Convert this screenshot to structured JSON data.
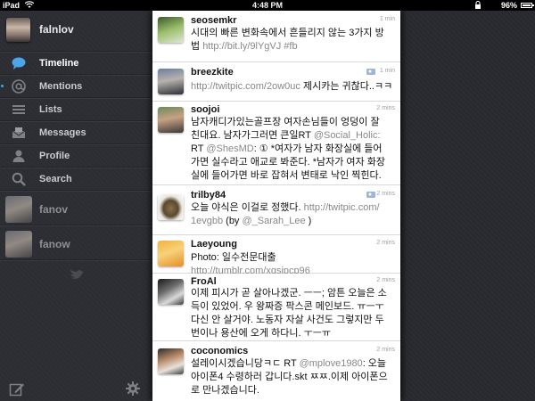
{
  "status_bar": {
    "carrier": "iPad",
    "time": "4:48 PM",
    "battery_pct": "96%",
    "battery_level": 0.96
  },
  "sidebar": {
    "account_name": "falnlov",
    "nav": [
      {
        "label": "Timeline",
        "icon": "speech-bubble-icon",
        "active": true
      },
      {
        "label": "Mentions",
        "icon": "at-sign-icon",
        "active": false,
        "unread": true
      },
      {
        "label": "Lists",
        "icon": "list-icon",
        "active": false
      },
      {
        "label": "Messages",
        "icon": "envelope-icon",
        "active": false
      },
      {
        "label": "Profile",
        "icon": "person-icon",
        "active": false
      },
      {
        "label": "Search",
        "icon": "magnifier-icon",
        "active": false
      }
    ],
    "other_accounts": [
      {
        "name": "fanov"
      },
      {
        "name": "fanow"
      }
    ],
    "compose_icon": "compose-icon",
    "settings_icon": "gear-icon"
  },
  "timeline": {
    "tweets": [
      {
        "user": "seosemkr",
        "time": "1 min",
        "line1": "시대의 빠른 변화속에서 흔들리지 않는 3가지 방",
        "line2_text": "법 ",
        "line2_link": "http://bit.ly/9lYgVJ #fb"
      },
      {
        "user": "breezkite",
        "time": "1 min",
        "link": "http://twitpic.com/2ow0uc",
        "text": " 제시카는 귀찮다..ㅋㅋ"
      },
      {
        "user": "soojoi",
        "time": "2 mins",
        "l1": "남자캐디가있는골프장 여자손님들이 엉덩이 잘",
        "l2_text": "친대요. 남자가그러면 큰일RT ",
        "l2_link": "@Social_Holic:",
        "l3_pre": "RT ",
        "l3_link": "@ShesMD",
        "l3_text": ": ① *여자가 남자 화장실에 들어",
        "l4": "가면 실수라고 애교로 봐준다. *남자가 여자 화장",
        "l5": "실에 들어가면 바로 잡혀서 변태로 낙인 찍힌다."
      },
      {
        "user": "trilby84",
        "time": "2 mins",
        "l1_text": "오늘 야식은 이걸로 정했다. ",
        "l1_link": "http://twitpic.com/",
        "l2_link": "1evgbb",
        "l2_text": " (by ",
        "l2_link2": "@_Sarah_Lee",
        "l2_end": " )"
      },
      {
        "user": "Laeyoung",
        "time": "2 mins",
        "text": "Photo: 일수전문대출 ",
        "link": "http://tumblr.com/xqsipcp96"
      },
      {
        "user": "FroAl",
        "time": "2 mins",
        "l1": "이제 피시가 곧 살아나겠군. ㅡㅡ; 암튼 오늘은 소",
        "l2": "득이 있었어. 우 왕짜증 팍스콘 메인보드. ㅠㅡㅜ",
        "l3": "다신 안 살거야. 노동자 자살 사건도 그렇지만 두",
        "l4": "번이나 용산에 오게 하다니. ㅜㅡㅠ"
      },
      {
        "user": "coconomics",
        "time": "2 mins",
        "l1_text": "설레이시겠습니당ㅋㄷ RT ",
        "l1_link": "@mplove1980",
        "l1_end": ": 오늘",
        "l2": "아이폰4 수령하러 갑니다.skt ㅉㅉ.이제 아이폰으",
        "l3": "로 만나겠습니다."
      }
    ]
  }
}
